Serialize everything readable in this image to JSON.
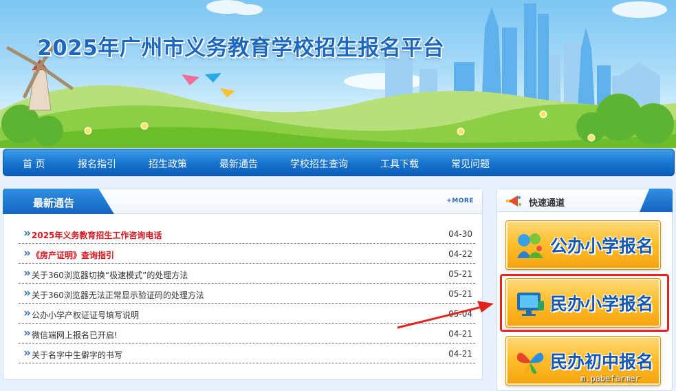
{
  "banner": {
    "title": "2025年广州市义务教育学校招生报名平台"
  },
  "nav": {
    "items": [
      "首 页",
      "报名指引",
      "招生政策",
      "最新通告",
      "学校招生查询",
      "工具下载",
      "常见问题"
    ]
  },
  "news": {
    "heading": "最新通告",
    "more_label": "+MORE",
    "items": [
      {
        "title": "2025年义务教育招生工作咨询电话",
        "date": "04-30",
        "hot": true
      },
      {
        "title": "《房产证明》查询指引",
        "date": "04-22",
        "hot": true
      },
      {
        "title": "关于360浏览器切换“极速模式”的处理方法",
        "date": "05-21",
        "hot": false
      },
      {
        "title": "关于360浏览器无法正常显示验证码的处理方法",
        "date": "05-21",
        "hot": false
      },
      {
        "title": "公办小学产权证证号填写说明",
        "date": "05-04",
        "hot": false
      },
      {
        "title": "微信端网上报名已开启!",
        "date": "04-21",
        "hot": false
      },
      {
        "title": "关于名字中生僻字的书写",
        "date": "04-21",
        "hot": false
      }
    ]
  },
  "quick": {
    "heading": "快速通道",
    "buttons": [
      {
        "label": "公办小学报名",
        "icon": "kids-icon"
      },
      {
        "label": "民办小学报名",
        "icon": "monitor-icon"
      },
      {
        "label": "民办初中报名",
        "icon": "butterfly-icon"
      }
    ]
  },
  "watermark": "m.pabefarmer",
  "colors": {
    "nav_blue": "#1673cf",
    "hot_red": "#d8141b",
    "button_orange": "#ffbf2e",
    "button_text": "#1457b2",
    "highlight_red": "#e3241d"
  }
}
